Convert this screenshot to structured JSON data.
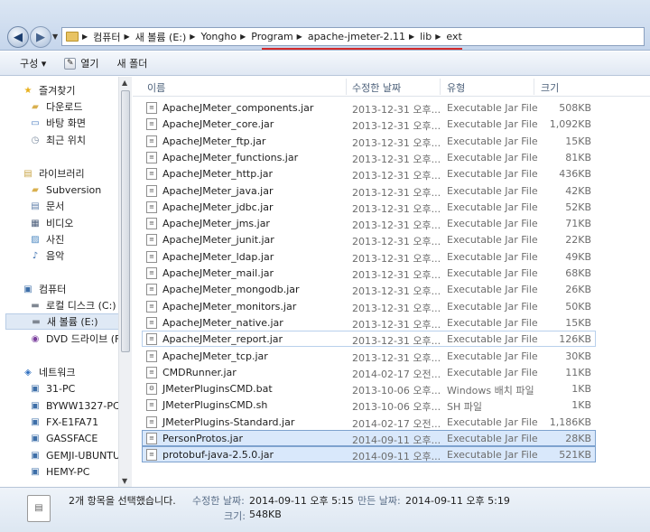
{
  "address": {
    "crumbs": [
      "컴퓨터",
      "새 볼륨 (E:)",
      "Yongho",
      "Program",
      "apache-jmeter-2.11",
      "lib",
      "ext"
    ]
  },
  "toolbar": {
    "organize": "구성 ▾",
    "open": "열기",
    "new_folder": "새 폴더"
  },
  "sidebar": {
    "items": [
      {
        "label": "즐겨찾기",
        "icon": "star-icon",
        "indent": 0
      },
      {
        "label": "다운로드",
        "icon": "folder-icon",
        "indent": 1
      },
      {
        "label": "바탕 화면",
        "icon": "desktop-icon",
        "indent": 1
      },
      {
        "label": "최근 위치",
        "icon": "recent-icon",
        "indent": 1
      },
      {
        "label": "라이브러리",
        "icon": "library-icon",
        "indent": 0
      },
      {
        "label": "Subversion",
        "icon": "library-folder-icon",
        "indent": 1
      },
      {
        "label": "문서",
        "icon": "documents-icon",
        "indent": 1
      },
      {
        "label": "비디오",
        "icon": "video-icon",
        "indent": 1
      },
      {
        "label": "사진",
        "icon": "pictures-icon",
        "indent": 1
      },
      {
        "label": "음악",
        "icon": "music-icon",
        "indent": 1
      },
      {
        "label": "컴퓨터",
        "icon": "computer-icon",
        "indent": 0
      },
      {
        "label": "로컬 디스크 (C:)",
        "icon": "drive-icon",
        "indent": 1
      },
      {
        "label": "새 볼륨 (E:)",
        "icon": "drive-icon",
        "indent": 1
      },
      {
        "label": "DVD 드라이브 (F",
        "icon": "dvd-icon",
        "indent": 1
      },
      {
        "label": "네트워크",
        "icon": "network-icon",
        "indent": 0
      },
      {
        "label": "31-PC",
        "icon": "pc-icon",
        "indent": 1
      },
      {
        "label": "BYWW1327-PC",
        "icon": "pc-icon",
        "indent": 1
      },
      {
        "label": "FX-E1FA71",
        "icon": "pc-icon",
        "indent": 1
      },
      {
        "label": "GASSFACE",
        "icon": "pc-icon",
        "indent": 1
      },
      {
        "label": "GEMJI-UBUNTU",
        "icon": "pc-icon",
        "indent": 1
      },
      {
        "label": "HEMY-PC",
        "icon": "pc-icon",
        "indent": 1
      }
    ]
  },
  "columns": [
    "이름",
    "수정한 날짜",
    "유형",
    "크기"
  ],
  "files": [
    {
      "name": "ApacheJMeter_components.jar",
      "date": "2013-12-31 오후...",
      "type": "Executable Jar File",
      "size": "508KB"
    },
    {
      "name": "ApacheJMeter_core.jar",
      "date": "2013-12-31 오후...",
      "type": "Executable Jar File",
      "size": "1,092KB"
    },
    {
      "name": "ApacheJMeter_ftp.jar",
      "date": "2013-12-31 오후...",
      "type": "Executable Jar File",
      "size": "15KB"
    },
    {
      "name": "ApacheJMeter_functions.jar",
      "date": "2013-12-31 오후...",
      "type": "Executable Jar File",
      "size": "81KB"
    },
    {
      "name": "ApacheJMeter_http.jar",
      "date": "2013-12-31 오후...",
      "type": "Executable Jar File",
      "size": "436KB"
    },
    {
      "name": "ApacheJMeter_java.jar",
      "date": "2013-12-31 오후...",
      "type": "Executable Jar File",
      "size": "42KB"
    },
    {
      "name": "ApacheJMeter_jdbc.jar",
      "date": "2013-12-31 오후...",
      "type": "Executable Jar File",
      "size": "52KB"
    },
    {
      "name": "ApacheJMeter_jms.jar",
      "date": "2013-12-31 오후...",
      "type": "Executable Jar File",
      "size": "71KB"
    },
    {
      "name": "ApacheJMeter_junit.jar",
      "date": "2013-12-31 오후...",
      "type": "Executable Jar File",
      "size": "22KB"
    },
    {
      "name": "ApacheJMeter_ldap.jar",
      "date": "2013-12-31 오후...",
      "type": "Executable Jar File",
      "size": "49KB"
    },
    {
      "name": "ApacheJMeter_mail.jar",
      "date": "2013-12-31 오후...",
      "type": "Executable Jar File",
      "size": "68KB"
    },
    {
      "name": "ApacheJMeter_mongodb.jar",
      "date": "2013-12-31 오후...",
      "type": "Executable Jar File",
      "size": "26KB"
    },
    {
      "name": "ApacheJMeter_monitors.jar",
      "date": "2013-12-31 오후...",
      "type": "Executable Jar File",
      "size": "50KB"
    },
    {
      "name": "ApacheJMeter_native.jar",
      "date": "2013-12-31 오후...",
      "type": "Executable Jar File",
      "size": "15KB"
    },
    {
      "name": "ApacheJMeter_report.jar",
      "date": "2013-12-31 오후...",
      "type": "Executable Jar File",
      "size": "126KB"
    },
    {
      "name": "ApacheJMeter_tcp.jar",
      "date": "2013-12-31 오후...",
      "type": "Executable Jar File",
      "size": "30KB"
    },
    {
      "name": "CMDRunner.jar",
      "date": "2014-02-17 오전...",
      "type": "Executable Jar File",
      "size": "11KB"
    },
    {
      "name": "JMeterPluginsCMD.bat",
      "date": "2013-10-06 오후...",
      "type": "Windows 배치 파일",
      "size": "1KB"
    },
    {
      "name": "JMeterPluginsCMD.sh",
      "date": "2013-10-06 오후...",
      "type": "SH 파일",
      "size": "1KB"
    },
    {
      "name": "JMeterPlugins-Standard.jar",
      "date": "2014-02-17 오전...",
      "type": "Executable Jar File",
      "size": "1,186KB"
    },
    {
      "name": "PersonProtos.jar",
      "date": "2014-09-11 오후...",
      "type": "Executable Jar File",
      "size": "28KB"
    },
    {
      "name": "protobuf-java-2.5.0.jar",
      "date": "2014-09-11 오후...",
      "type": "Executable Jar File",
      "size": "521KB"
    }
  ],
  "details": {
    "selected_count": "2개 항목을 선택했습니다.",
    "modified_label": "수정한 날짜:",
    "modified_value": "2014-09-11 오후 5:15",
    "created_label": "만든 날짜:",
    "created_value": "2014-09-11 오후 5:19",
    "size_label": "크기:",
    "size_value": "548KB"
  }
}
